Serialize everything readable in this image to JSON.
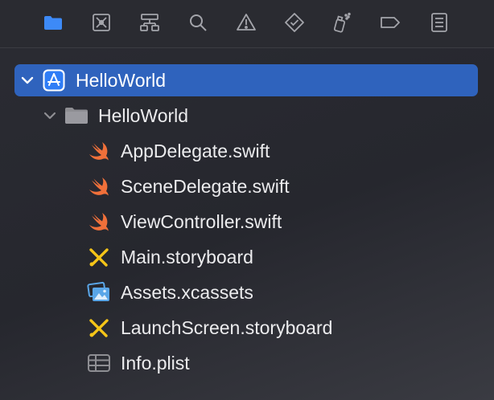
{
  "toolbar": {
    "items": [
      {
        "name": "folder-icon",
        "color": "#3d8af7"
      },
      {
        "name": "source-control-icon"
      },
      {
        "name": "hierarchy-icon"
      },
      {
        "name": "search-icon"
      },
      {
        "name": "warning-icon"
      },
      {
        "name": "test-diamond-icon"
      },
      {
        "name": "debug-spray-icon"
      },
      {
        "name": "tag-icon"
      },
      {
        "name": "report-list-icon"
      }
    ]
  },
  "tree": {
    "project": {
      "label": "HelloWorld",
      "icon": "app-project-icon"
    },
    "group": {
      "label": "HelloWorld",
      "icon": "folder-icon"
    },
    "files": [
      {
        "label": "AppDelegate.swift",
        "icon": "swift-icon"
      },
      {
        "label": "SceneDelegate.swift",
        "icon": "swift-icon"
      },
      {
        "label": "ViewController.swift",
        "icon": "swift-icon"
      },
      {
        "label": "Main.storyboard",
        "icon": "storyboard-icon"
      },
      {
        "label": "Assets.xcassets",
        "icon": "assets-icon"
      },
      {
        "label": "LaunchScreen.storyboard",
        "icon": "storyboard-icon"
      },
      {
        "label": "Info.plist",
        "icon": "plist-icon"
      }
    ]
  },
  "colors": {
    "selection": "#2f63bd",
    "swift": "#f0703a",
    "storyboard": "#f5c518",
    "assets": "#5aa6e8",
    "folder": "#8e8e93"
  }
}
